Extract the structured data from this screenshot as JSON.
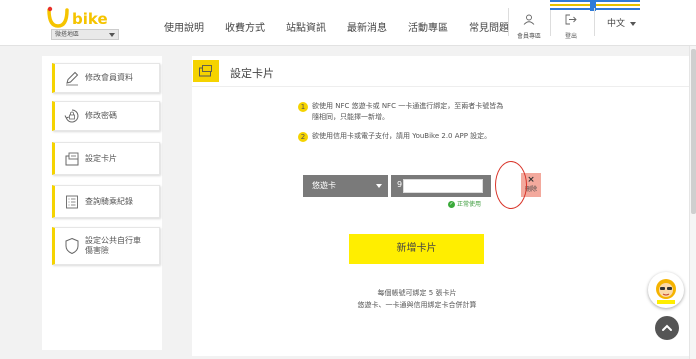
{
  "header": {
    "region": "微搭地區",
    "nav": [
      "使用說明",
      "收費方式",
      "站點資訊",
      "最新消息",
      "活動專區",
      "常見問題"
    ],
    "member_label": "會員專區",
    "logout_label": "登出",
    "language": "中文"
  },
  "sidebar": {
    "items": [
      {
        "label": "修改會員資料",
        "icon": "pencil-icon"
      },
      {
        "label": "修改密碼",
        "icon": "lock-refresh-icon"
      },
      {
        "label": "設定卡片",
        "icon": "card-icon"
      },
      {
        "label": "查詢騎乘紀錄",
        "icon": "list-icon"
      },
      {
        "label": "設定公共自行車傷害險",
        "line1": "設定公共自行車",
        "line2": "傷害險",
        "icon": "shield-icon"
      }
    ]
  },
  "main": {
    "title": "設定卡片",
    "notes": [
      {
        "num": "1",
        "line1": "欲使用 NFC 悠遊卡或 NFC 一卡通進行綁定，至兩者卡號皆為",
        "line2": "隨相同，只能擇一新增。"
      },
      {
        "num": "2",
        "line1": "欲使用信用卡或電子支付，請用 YouBike 2.0 APP 設定。"
      }
    ],
    "card_type": "悠遊卡",
    "card_prefix": "9",
    "card_number_value": "",
    "delete_x": "×",
    "delete_label": "刪除",
    "status": "正常使用",
    "add_button": "新增卡片",
    "limit_line1": "每個帳號可綁定 5 張卡片",
    "limit_line2": "悠遊卡、一卡通與信用綁定卡合併計算"
  },
  "colors": {
    "accent_yellow": "#ffee00",
    "title_yellow": "#f5d300",
    "delete_bg": "#f3a99d",
    "status_green": "#3a9b3a",
    "ring_red": "#d9362b"
  }
}
